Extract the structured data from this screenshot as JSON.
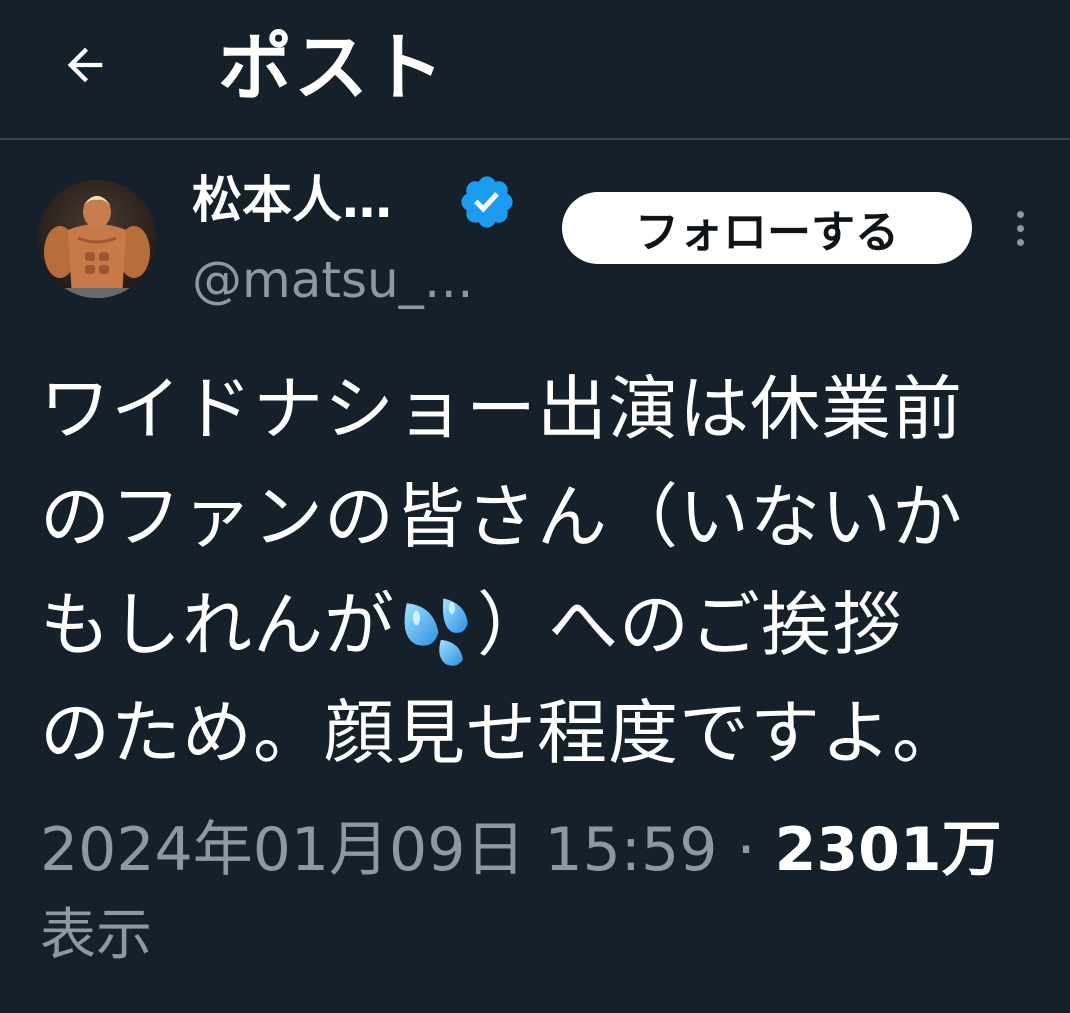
{
  "header": {
    "title": "ポスト",
    "back_icon": "arrow-left-icon"
  },
  "author": {
    "display_name": "松本人…",
    "handle": "@matsu_…",
    "verified": true,
    "verified_color": "#1d9bf0"
  },
  "actions": {
    "follow_label": "フォローする",
    "more_icon": "more-vertical-icon"
  },
  "tweet": {
    "lines": [
      "ワイドナショー出演は休業前",
      "のファンの皆さん（いないか",
      "もしれんが",
      "）へのご挨拶",
      "のため。顔見せ程度ですよ。"
    ],
    "emoji": "sweat-droplets-emoji"
  },
  "meta": {
    "timestamp": "2024年01月09日 15:59",
    "separator": "·",
    "views_count": "2301万",
    "views_label": "表示"
  },
  "colors": {
    "background": "#15202b",
    "muted_text": "#8b98a5",
    "divider": "#38444d"
  }
}
